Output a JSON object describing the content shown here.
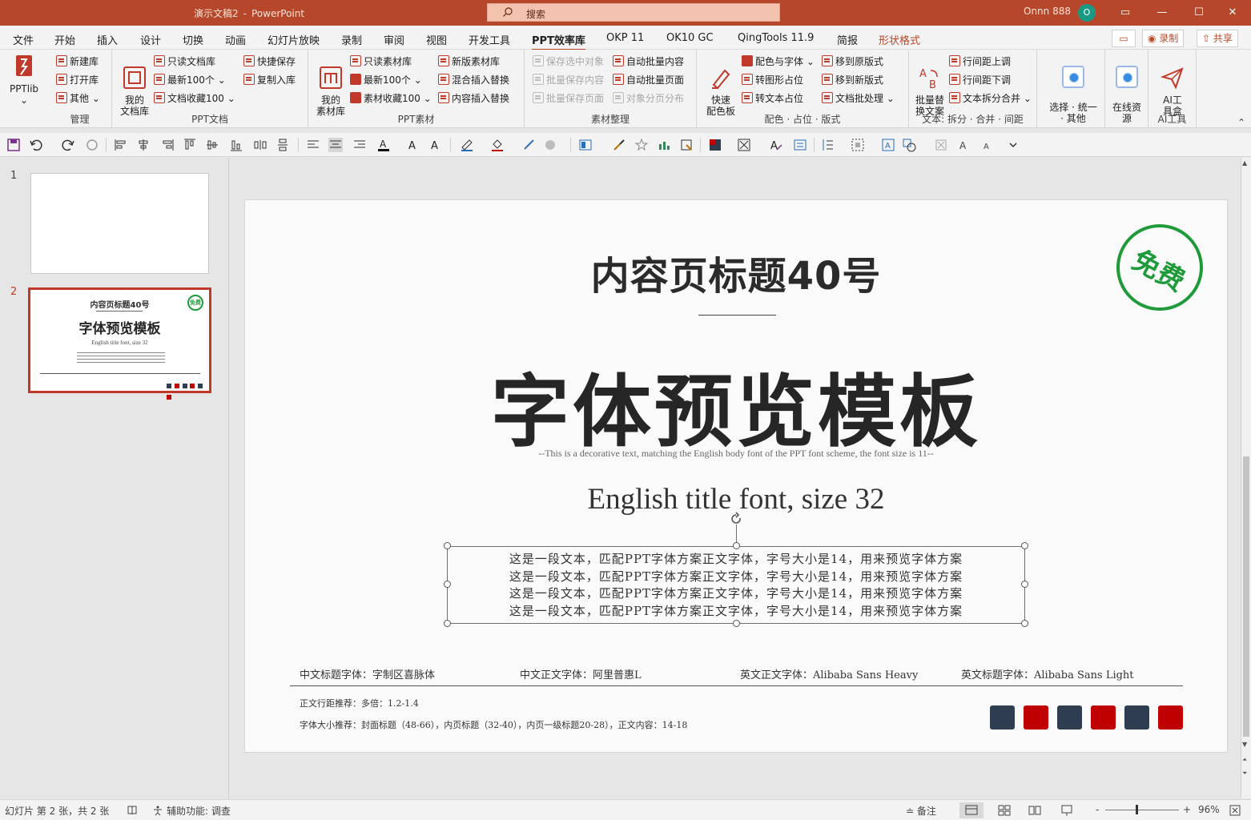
{
  "titlebar": {
    "doc_name": "演示文稿2",
    "separator": "-",
    "app_name": "PowerPoint",
    "search_placeholder": "搜索",
    "user_name": "Onnn 888",
    "avatar_letter": "O",
    "minimize": "—",
    "restore": "▭",
    "maximize": "☐",
    "close": "✕"
  },
  "tabs": [
    "文件",
    "开始",
    "插入",
    "设计",
    "切换",
    "动画",
    "幻灯片放映",
    "录制",
    "审阅",
    "视图",
    "开发工具",
    "PPT效率库",
    "OKP 11",
    "OK10 GC",
    "QingTools 11.9",
    "简报",
    "形状格式"
  ],
  "top_buttons": {
    "record": "录制",
    "share": "共享"
  },
  "ribbon": {
    "pptlib": "PPTlib",
    "manage": {
      "label": "管理",
      "items": [
        "新建库",
        "打开库",
        "其他"
      ]
    },
    "pptdoc": {
      "label": "PPT文档",
      "big": "我的\n文档库",
      "items": [
        "只读文档库",
        "最新100个",
        "文档收藏100",
        "快捷保存",
        "复制入库"
      ]
    },
    "pptmat": {
      "label": "PPT素材",
      "big": "我的\n素材库",
      "items": [
        "只读素材库",
        "最新100个",
        "素材收藏100",
        "新版素材库",
        "混合插入替换",
        "内容插入替换"
      ]
    },
    "matorg": {
      "label": "素材整理",
      "items": [
        "保存选中对象",
        "批量保存内容",
        "批量保存页面",
        "自动批量内容",
        "自动批量页面",
        "对象分页分布"
      ]
    },
    "color": {
      "label": "配色 · 占位 · 版式",
      "big": "快速\n配色板",
      "items": [
        "配色与字体",
        "转图形占位",
        "转文本占位",
        "移到原版式",
        "移到新版式",
        "文档批处理"
      ]
    },
    "text": {
      "label": "文本: 拆分 · 合并 · 间距",
      "big": "批量替\n换文案",
      "items": [
        "行间距上调",
        "行间距下调",
        "文本拆分合并"
      ]
    },
    "select": {
      "label": "选择 · 统一\n· 其他"
    },
    "online": {
      "label": "在线资\n源"
    },
    "ai": {
      "label": "AI工具",
      "big": "AI工\n具盒"
    }
  },
  "thumbnails": [
    {
      "num": "1"
    },
    {
      "num": "2",
      "title": "内容页标题40号",
      "hero": "字体预览模板",
      "eng": "English title font, size 32"
    }
  ],
  "slide": {
    "title": "内容页标题40号",
    "hero": "字体预览模板",
    "decorative": "--This is a decorative text, matching the English body font of the PPT font scheme, the font size is 11--",
    "english_title": "English title font, size 32",
    "body_lines": [
      "这是一段文本，匹配PPT字体方案正文字体，字号大小是14，用来预览字体方案",
      "这是一段文本，匹配PPT字体方案正文字体，字号大小是14，用来预览字体方案",
      "这是一段文本，匹配PPT字体方案正文字体，字号大小是14，用来预览字体方案",
      "这是一段文本，匹配PPT字体方案正文字体，字号大小是14，用来预览字体方案"
    ],
    "fonts": [
      "中文标题字体：字制区喜脉体",
      "中文正文字体：阿里普惠L",
      "英文正文字体：Alibaba Sans Heavy",
      "英文标题字体：Alibaba Sans Light"
    ],
    "line_spacing": "正文行距推荐：多倍：1.2-1.4",
    "size_recommend": "字体大小推荐：封面标题（48-66），内页标题（32-40），内页一级标题20-28），正文内容：14-18",
    "stamp": "免费",
    "swatch_colors": [
      "#2e3e50",
      "#c00000",
      "#2e3e50",
      "#c00000",
      "#2e3e50",
      "#c00000"
    ]
  },
  "status": {
    "slide_info": "幻灯片 第 2 张，共 2 张",
    "accessibility": "辅助功能: 调查",
    "notes": "备注",
    "zoom": "96%",
    "zoom_minus": "-",
    "zoom_plus": "+"
  }
}
